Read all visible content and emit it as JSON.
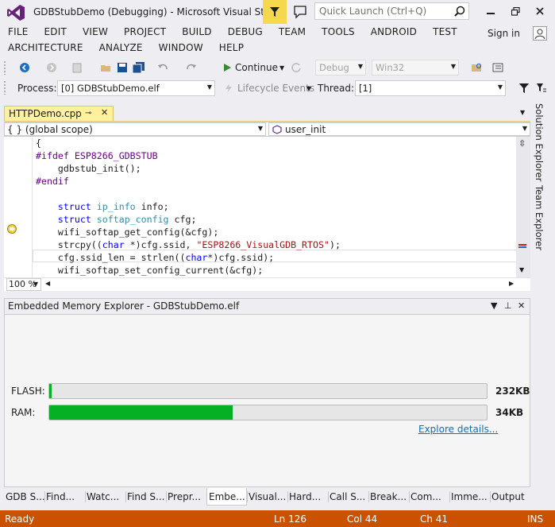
{
  "window": {
    "title": "GDBStubDemo (Debugging) - Microsoft Visual Studio",
    "quick_launch_placeholder": "Quick Launch (Ctrl+Q)",
    "sign_in": "Sign in"
  },
  "menu_row1": [
    "FILE",
    "EDIT",
    "VIEW",
    "PROJECT",
    "BUILD",
    "DEBUG",
    "TEAM",
    "TOOLS",
    "ANDROID",
    "TEST"
  ],
  "menu_row2": [
    "ARCHITECTURE",
    "ANALYZE",
    "WINDOW",
    "HELP"
  ],
  "toolbar": {
    "continue_label": "Continue",
    "config": "Debug",
    "platform": "Win32"
  },
  "debug_location": {
    "process_label": "Process:",
    "process_value": "[0] GDBStubDemo.elf",
    "lifecycle_label": "Lifecycle Events",
    "thread_label": "Thread:",
    "thread_value": "[1]"
  },
  "document": {
    "tab_label": "HTTPDemo.cpp",
    "scope": "{ } (global scope)",
    "function": "user_init",
    "zoom": "100 %"
  },
  "code_lines": [
    "{",
    "#ifdef ESP8266_GDBSTUB",
    "    gdbstub_init();",
    "#endif",
    "",
    "    struct ip_info info;",
    "    struct softap_config cfg;",
    "    wifi_softap_get_config(&cfg);",
    "    strcpy((char *)cfg.ssid, \"ESP8266_VisualGDB_RTOS\");",
    "    cfg.ssid_len = strlen((char*)cfg.ssid);",
    "    wifi_softap_set_config_current(&cfg);"
  ],
  "side_tabs": [
    "Solution Explorer",
    "Team Explorer"
  ],
  "memory_explorer": {
    "title": "Embedded Memory Explorer - GDBStubDemo.elf",
    "flash_label": "FLASH:",
    "flash_size": "232KB",
    "flash_fill": 0.005,
    "ram_label": "RAM:",
    "ram_size": "34KB",
    "ram_fill": 0.42,
    "explore_link": "Explore details..."
  },
  "bottom_tabs": [
    "GDB S...",
    "Find...",
    "Watc...",
    "Find S...",
    "Prepr...",
    "Embe...",
    "Visual...",
    "Hard...",
    "Call S...",
    "Break...",
    "Com...",
    "Imme...",
    "Output"
  ],
  "active_bottom_tab": 5,
  "status": {
    "state": "Ready",
    "line": "Ln 126",
    "col": "Col 44",
    "ch": "Ch 41",
    "mode": "INS"
  },
  "colors": {
    "status_bar": "#ca5100",
    "progress": "#06b025",
    "active_tab": "#fff29d"
  }
}
